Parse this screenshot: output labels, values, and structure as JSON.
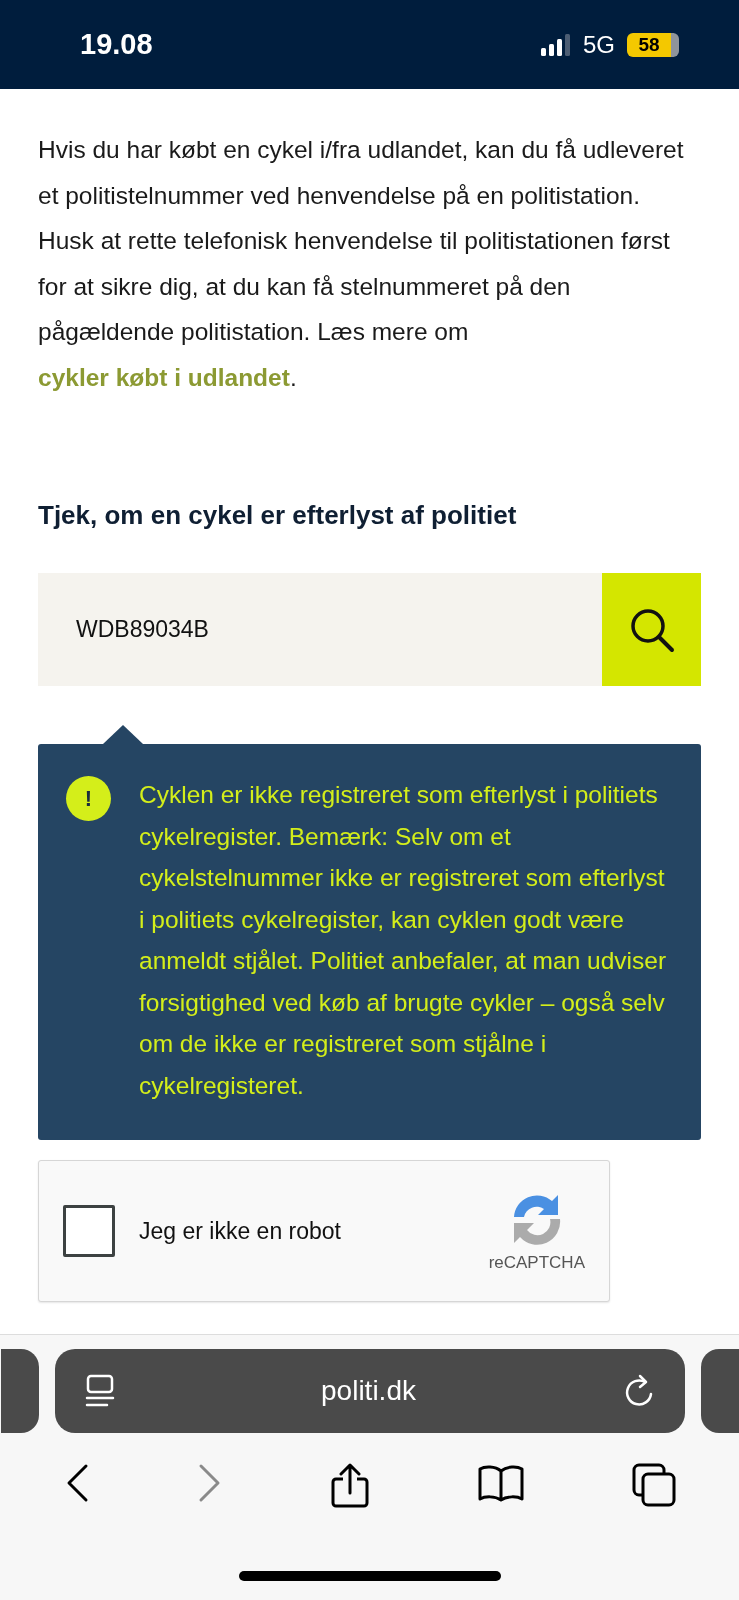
{
  "status_bar": {
    "time": "19.08",
    "network": "5G",
    "battery": "58"
  },
  "intro": {
    "text": "Hvis du har købt en cykel i/fra udlandet, kan du få udleveret et politistelnummer ved henvendelse på en politistation. Husk at rette telefonisk henvendelse til politistationen først for at sikre dig, at du kan få stelnummeret på den pågældende politistation. Læs mere om ",
    "link": "cykler købt i udlandet",
    "after": "."
  },
  "search": {
    "heading": "Tjek, om en cykel er efterlyst af politiet",
    "value": "WDB89034B"
  },
  "alert": {
    "icon": "!",
    "text": "Cyklen er ikke registreret som efterlyst i politiets cykelregister. Bemærk: Selv om et cykelstelnummer ikke er registreret som efterlyst i politiets cykelregister, kan cyklen godt være anmeldt stjålet. Politiet anbefaler, at man udviser forsigtighed ved køb af brugte cykler – også selv om de ikke er registreret som stjålne i cykelregisteret."
  },
  "captcha": {
    "label": "Jeg er ikke en robot",
    "checked": false,
    "brand": "reCAPTCHA"
  },
  "browser": {
    "url": "politi.dk",
    "back_disabled": false,
    "forward_disabled": true
  }
}
